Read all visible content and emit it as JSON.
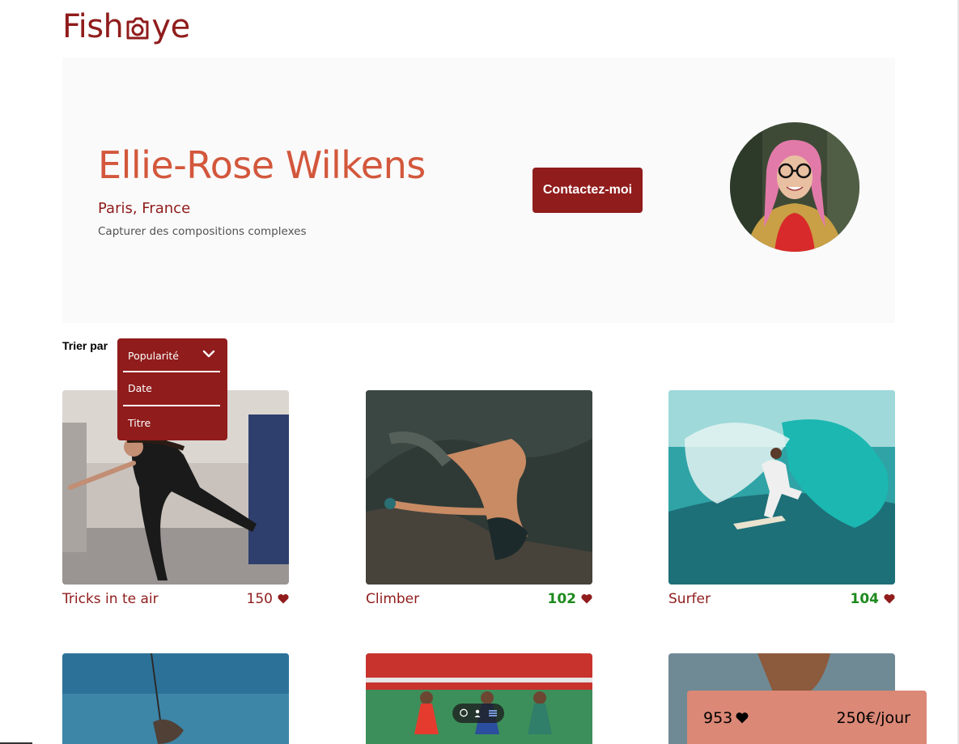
{
  "logo": {
    "part1": "Fish",
    "part2": "ye",
    "icon": "camera-icon"
  },
  "photographer": {
    "name": "Ellie-Rose Wilkens",
    "location": "Paris, France",
    "tagline": "Capturer des compositions complexes"
  },
  "contact_button": "Contactez-moi",
  "sort": {
    "label": "Trier par",
    "options": [
      "Popularité",
      "Date",
      "Titre"
    ],
    "selected": "Popularité",
    "expanded": true
  },
  "media": [
    {
      "title": "Tricks in te air",
      "likes": "150",
      "liked": false
    },
    {
      "title": "Climber",
      "likes": "102",
      "liked": true
    },
    {
      "title": "Surfer",
      "likes": "104",
      "liked": true
    }
  ],
  "summary": {
    "total_likes": "953",
    "price": "250€/jour"
  },
  "colors": {
    "primary": "#901C1C",
    "secondary": "#D3573C",
    "accent": "#DB8876",
    "liked": "#1E8A1E",
    "header_bg": "#FAFAFA"
  }
}
